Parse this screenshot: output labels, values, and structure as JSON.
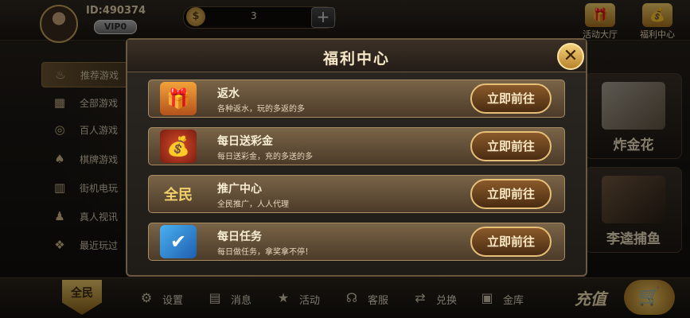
{
  "header": {
    "user_id": "ID:490374",
    "vip": "VIP0",
    "coins": "3",
    "plus": "+",
    "events_label": "活动大厅",
    "welfare_label": "福利中心"
  },
  "sidebar": {
    "items": [
      {
        "label": "推荐游戏",
        "icon": "flame-icon",
        "active": true
      },
      {
        "label": "全部游戏",
        "icon": "grid-icon",
        "active": false
      },
      {
        "label": "百人游戏",
        "icon": "chips-icon",
        "active": false
      },
      {
        "label": "棋牌游戏",
        "icon": "cards-icon",
        "active": false
      },
      {
        "label": "街机电玩",
        "icon": "arcade-icon",
        "active": false
      },
      {
        "label": "真人视讯",
        "icon": "person-icon",
        "active": false
      },
      {
        "label": "最近玩过",
        "icon": "footprint-icon",
        "active": false
      }
    ]
  },
  "tiles": [
    {
      "label": "炸金花"
    },
    {
      "label": "李逵捕鱼"
    }
  ],
  "modal": {
    "title": "福利中心",
    "close": "✕",
    "rows": [
      {
        "title": "返水",
        "desc": "各种返水，玩的多返的多",
        "button": "立即前往",
        "icon": "gift-box-icon"
      },
      {
        "title": "每日送彩金",
        "desc": "每日送彩金，充的多送的多",
        "button": "立即前往",
        "icon": "money-bag-icon"
      },
      {
        "title": "推广中心",
        "desc": "全民推广，人人代理",
        "button": "立即前往",
        "icon": "promo-badge-icon"
      },
      {
        "title": "每日任务",
        "desc": "每日做任务，拿奖拿不停！",
        "button": "立即前往",
        "icon": "task-checklist-icon"
      }
    ]
  },
  "bottom_nav": {
    "settings": "设置",
    "messages": "消息",
    "activity": "活动",
    "service": "客服",
    "exchange": "兑换",
    "vault": "金库",
    "recharge": "充值"
  },
  "colors": {
    "accent_gold": "#e6bf79",
    "row_bg": "#6b563c",
    "modal_bg": "#2b2722"
  }
}
